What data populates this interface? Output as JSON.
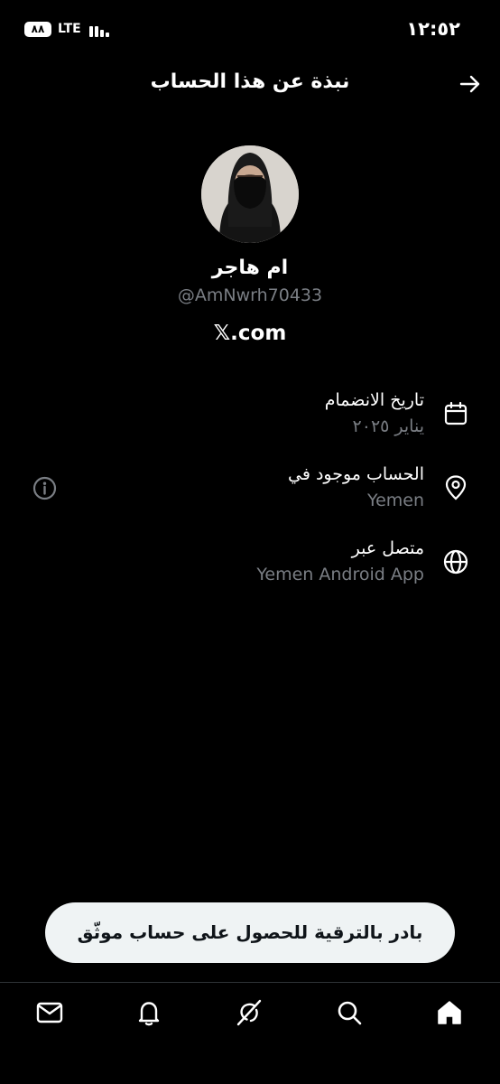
{
  "status_bar": {
    "battery": "٨٨",
    "network": "LTE",
    "time": "١٢:٥٢"
  },
  "header": {
    "title": "نبذة عن هذا الحساب"
  },
  "profile": {
    "display_name": "ام هاجر",
    "handle": "@AmNwrh70433",
    "site": "𝕏.com"
  },
  "info": {
    "joined": {
      "label": "تاريخ الانضمام",
      "value": "يناير ٢٠٢٥",
      "icon": "calendar-icon"
    },
    "location": {
      "label": "الحساب موجود في",
      "value": "Yemen",
      "icon": "location-pin-icon"
    },
    "connected": {
      "label": "متصل عبر",
      "value": "Yemen Android App",
      "icon": "globe-icon"
    }
  },
  "upgrade_button": {
    "label": "بادر بالترقية للحصول على حساب موثّق"
  },
  "nav": [
    "mail-icon",
    "bell-icon",
    "grok-icon",
    "search-icon",
    "home-icon"
  ],
  "colors": {
    "background": "#000000",
    "text": "#ffffff",
    "secondary_text": "#7a7e84",
    "button_bg": "#eff3f4"
  }
}
